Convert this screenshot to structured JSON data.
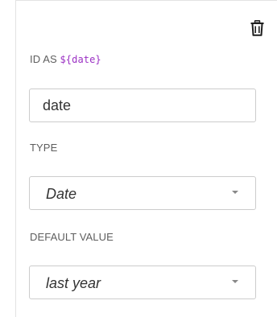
{
  "variable_editor": {
    "delete_icon": "trash-icon",
    "id_label_prefix": "ID AS",
    "id_label_code": "${date}",
    "id_value": "date",
    "type_label": "TYPE",
    "type_value": "Date",
    "default_label": "DEFAULT VALUE",
    "default_value": "last year",
    "colors": {
      "code": "#9b30c4",
      "label": "#5e5e5e",
      "text": "#333333",
      "border": "#cccccc"
    }
  }
}
